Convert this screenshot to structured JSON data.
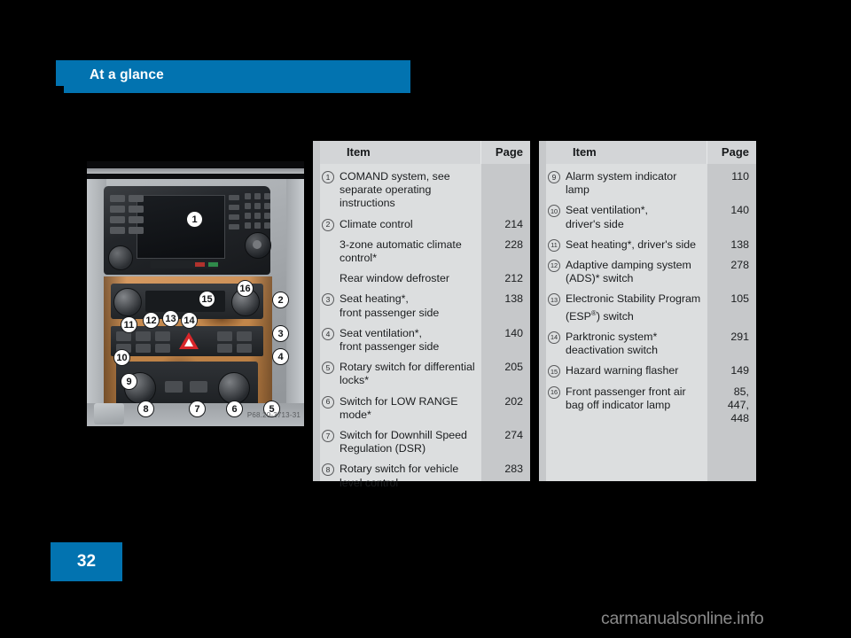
{
  "header": {
    "title": "At a glance"
  },
  "page_number": "32",
  "watermark": "carmanualsonline.info",
  "figure": {
    "credit": "P68.20-3713-31",
    "callouts": [
      {
        "n": "1"
      },
      {
        "n": "2"
      },
      {
        "n": "3"
      },
      {
        "n": "4"
      },
      {
        "n": "5"
      },
      {
        "n": "6"
      },
      {
        "n": "7"
      },
      {
        "n": "8"
      },
      {
        "n": "9"
      },
      {
        "n": "10"
      },
      {
        "n": "11"
      },
      {
        "n": "12"
      },
      {
        "n": "13"
      },
      {
        "n": "14"
      },
      {
        "n": "15"
      },
      {
        "n": "16"
      }
    ]
  },
  "tables": [
    {
      "headers": {
        "item": "Item",
        "page": "Page"
      },
      "rows": [
        {
          "num": "1",
          "label": "COMAND system, see separate operating instructions",
          "page": ""
        },
        {
          "num": "2",
          "label": "Climate control",
          "page": "214"
        },
        {
          "num": "",
          "label": "3-zone automatic climate control*",
          "page": "228"
        },
        {
          "num": "",
          "label": "Rear window defroster",
          "page": "212"
        },
        {
          "num": "3",
          "label": "Seat heating*,\nfront passenger side",
          "page": "138"
        },
        {
          "num": "4",
          "label": "Seat ventilation*,\nfront passenger side",
          "page": "140"
        },
        {
          "num": "5",
          "label": "Rotary switch for differential locks*",
          "page": "205"
        },
        {
          "num": "6",
          "label": "Switch for LOW RANGE mode*",
          "page": "202"
        },
        {
          "num": "7",
          "label": "Switch for Downhill Speed Regulation (DSR)",
          "page": "274"
        },
        {
          "num": "8",
          "label": "Rotary switch for vehicle level control",
          "page": "283"
        }
      ]
    },
    {
      "headers": {
        "item": "Item",
        "page": "Page"
      },
      "rows": [
        {
          "num": "9",
          "label": "Alarm system indicator lamp",
          "page": "110"
        },
        {
          "num": "10",
          "label": "Seat ventilation*,\ndriver's side",
          "page": "140"
        },
        {
          "num": "11",
          "label": "Seat heating*, driver's side",
          "page": "138"
        },
        {
          "num": "12",
          "label": "Adaptive damping system (ADS)* switch",
          "page": "278"
        },
        {
          "num": "13",
          "label": "Electronic Stability Program (ESP®) switch",
          "page": "105"
        },
        {
          "num": "14",
          "label": "Parktronic system* deactivation switch",
          "page": "291"
        },
        {
          "num": "15",
          "label": "Hazard warning flasher",
          "page": "149"
        },
        {
          "num": "16",
          "label": "Front passenger front air bag off indicator lamp",
          "page": "85,\n447,\n448"
        }
      ]
    }
  ],
  "colors": {
    "accent": "#0273b0",
    "table_header_bg": "#d3d5d7",
    "table_item_bg": "#dcdedf",
    "table_page_bg": "#c6c8ca"
  }
}
